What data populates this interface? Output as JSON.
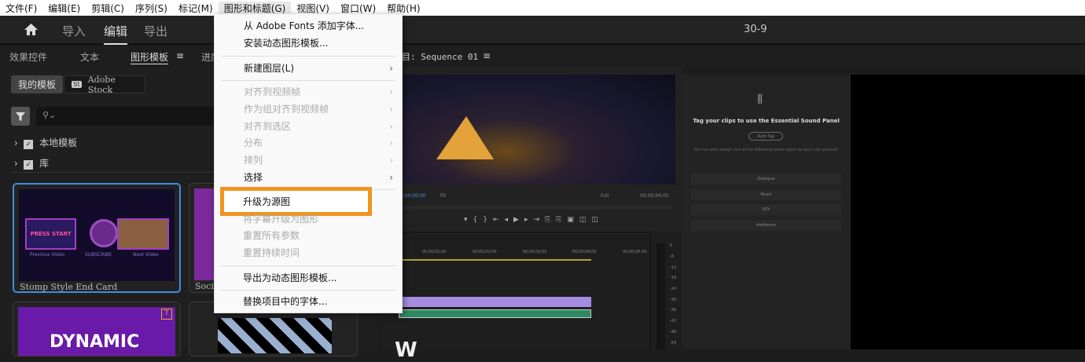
{
  "menubar": [
    "文件(F)",
    "编辑(E)",
    "剪辑(C)",
    "序列(S)",
    "标记(M)",
    "图形和标题(G)",
    "视图(V)",
    "窗口(W)",
    "帮助(H)"
  ],
  "header": {
    "tabs": [
      "导入",
      "编辑",
      "导出"
    ],
    "title": "30-9"
  },
  "panel_tabs": {
    "effects": "效果控件",
    "text": "文本",
    "templates": "图形模板",
    "progress": "进度",
    "program": "节目: Sequence 01"
  },
  "templates": {
    "my": "我的模板",
    "stock": "Adobe Stock",
    "stock_badge": "St",
    "tree": [
      "本地模板",
      "库"
    ],
    "cards": [
      {
        "label": "Stomp Style End Card",
        "texts": [
          "PRESS START",
          "Previous Video",
          "SUBSCRIBE",
          "Next Video"
        ]
      },
      {
        "label": "Social"
      },
      {
        "label": "",
        "texts": [
          "DYNAMIC"
        ]
      }
    ]
  },
  "menu": {
    "items": [
      {
        "label": "从 Adobe Fonts 添加字体...",
        "enabled": true
      },
      {
        "label": "安装动态图形模板...",
        "enabled": true
      },
      {
        "label": "新建图层(L)",
        "enabled": true,
        "submenu": true
      },
      {
        "label": "对齐到视频帧",
        "enabled": false,
        "submenu": true
      },
      {
        "label": "作为组对齐到视频帧",
        "enabled": false,
        "submenu": true
      },
      {
        "label": "对齐到选区",
        "enabled": false,
        "submenu": true
      },
      {
        "label": "分布",
        "enabled": false,
        "submenu": true
      },
      {
        "label": "排列",
        "enabled": false,
        "submenu": true
      },
      {
        "label": "选择",
        "enabled": true,
        "submenu": true
      },
      {
        "label": "升级为源图",
        "enabled": true,
        "highlighted": true
      },
      {
        "label": "将字幕升级为图形",
        "enabled": false
      },
      {
        "label": "重置所有参数",
        "enabled": false
      },
      {
        "label": "重置持续时间",
        "enabled": false
      },
      {
        "label": "导出为动态图形模板...",
        "enabled": true
      },
      {
        "label": "替换项目中的字体...",
        "enabled": true
      }
    ]
  },
  "monitor": {
    "timecode": "00;00;00;00",
    "fit": "Fit",
    "quality": "Full",
    "duration": "00;00;04;05"
  },
  "sound": {
    "title": "Tag your clips to use the Essential Sound Panel",
    "auto_tag": "Auto Tag",
    "hint": "You can also assign one of the following audio types to each clip yourself.",
    "types": [
      "Dialogue",
      "Music",
      "SFX",
      "Ambience"
    ]
  },
  "timeline": {
    "ruler": [
      "00;00;01;00",
      "00;00;02;00",
      "00;00;03;00",
      "00;00;04;00",
      "00;00;05;00"
    ],
    "meter": [
      "0",
      "-6",
      "-12",
      "-18",
      "-24",
      "-30",
      "-36",
      "-42",
      "-48",
      "-54"
    ]
  },
  "colors": {
    "highlight": "#f0951f",
    "selection": "#3e8ede",
    "video_clip": "#a48de0",
    "audio_clip": "#2e8a62"
  }
}
